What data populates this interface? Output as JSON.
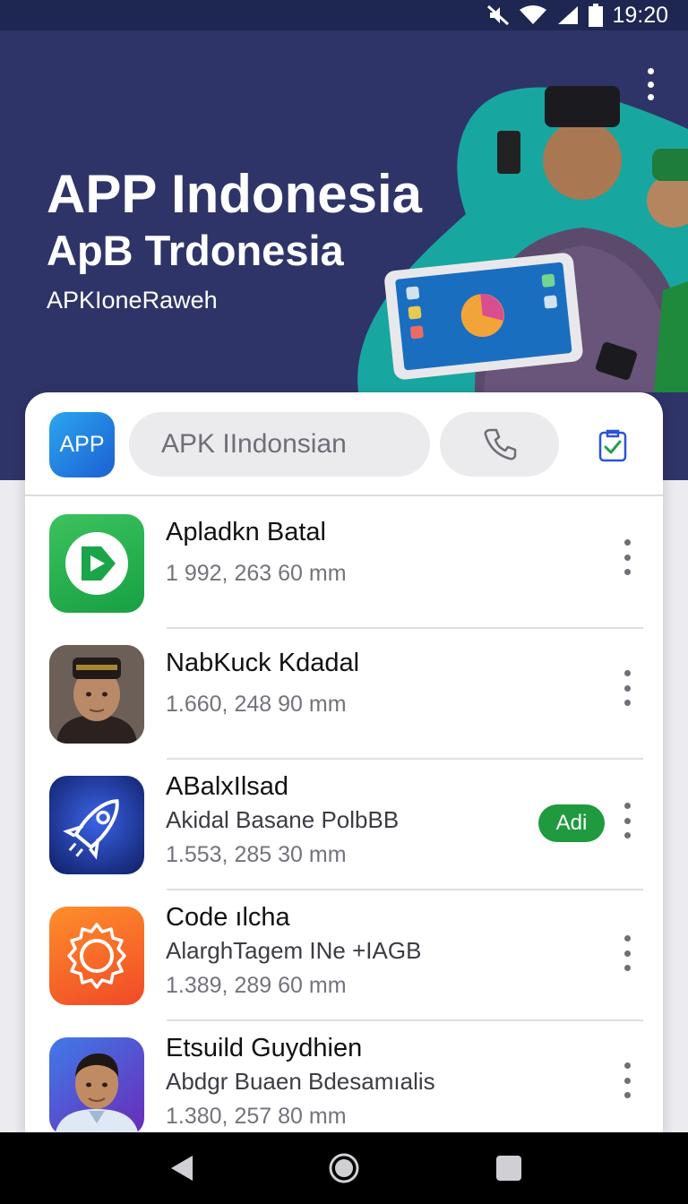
{
  "status_bar": {
    "time": "19:20",
    "icons": [
      "mute-icon",
      "wifi-icon",
      "signal-icon",
      "battery-icon"
    ]
  },
  "hero": {
    "title": "APP Indonesia",
    "subtitle": "ApB Trdonesia",
    "caption": "APKIoneRaweh",
    "overflow_icon": "more-vert-icon",
    "colors": {
      "background": "#2f3468",
      "accent": "#18a6a0"
    }
  },
  "search_bar": {
    "logo_label": "APP",
    "placeholder": "APK IIndonsian",
    "call_icon": "phone-icon",
    "clipboard_icon": "clipboard-check-icon"
  },
  "apps": [
    {
      "title": "Apladkn Batal",
      "subtitle": "",
      "meta": "1 992, 263 60 mm",
      "badge": "",
      "icon": "play-arrow-icon",
      "colors": [
        "#3cc25e",
        "#17a043"
      ]
    },
    {
      "title": "NabKuck Kdadal",
      "subtitle": "",
      "meta": "1.660, 248 90 mm",
      "badge": "",
      "icon": "man-portrait-icon",
      "colors": [
        "#b98a67",
        "#2a1f1c"
      ]
    },
    {
      "title": "ABalxIlsad",
      "subtitle": "Akidal Basane PolbBB",
      "meta": "1.553, 285 30 mm",
      "badge": "Adi",
      "icon": "rocket-icon",
      "colors": [
        "#2b4fd3",
        "#0f1d63"
      ]
    },
    {
      "title": "Code ılcha",
      "subtitle": "AlarghTagem INe +IAGB",
      "meta": "1.389, 289 60 mm",
      "badge": "",
      "icon": "sun-badge-icon",
      "colors": [
        "#ff8e2b",
        "#f04a27"
      ]
    },
    {
      "title": "Etsuild Guydhien",
      "subtitle": "Abdgr Buaen Bdesamıalis",
      "meta": "1.380, 257 80 mm",
      "badge": "",
      "icon": "man-portrait-icon",
      "colors": [
        "#3f7be8",
        "#6b2ab8"
      ]
    }
  ],
  "nav_bar": {
    "back_icon": "back-triangle-icon",
    "home_icon": "home-circle-icon",
    "recents_icon": "recents-square-icon"
  }
}
